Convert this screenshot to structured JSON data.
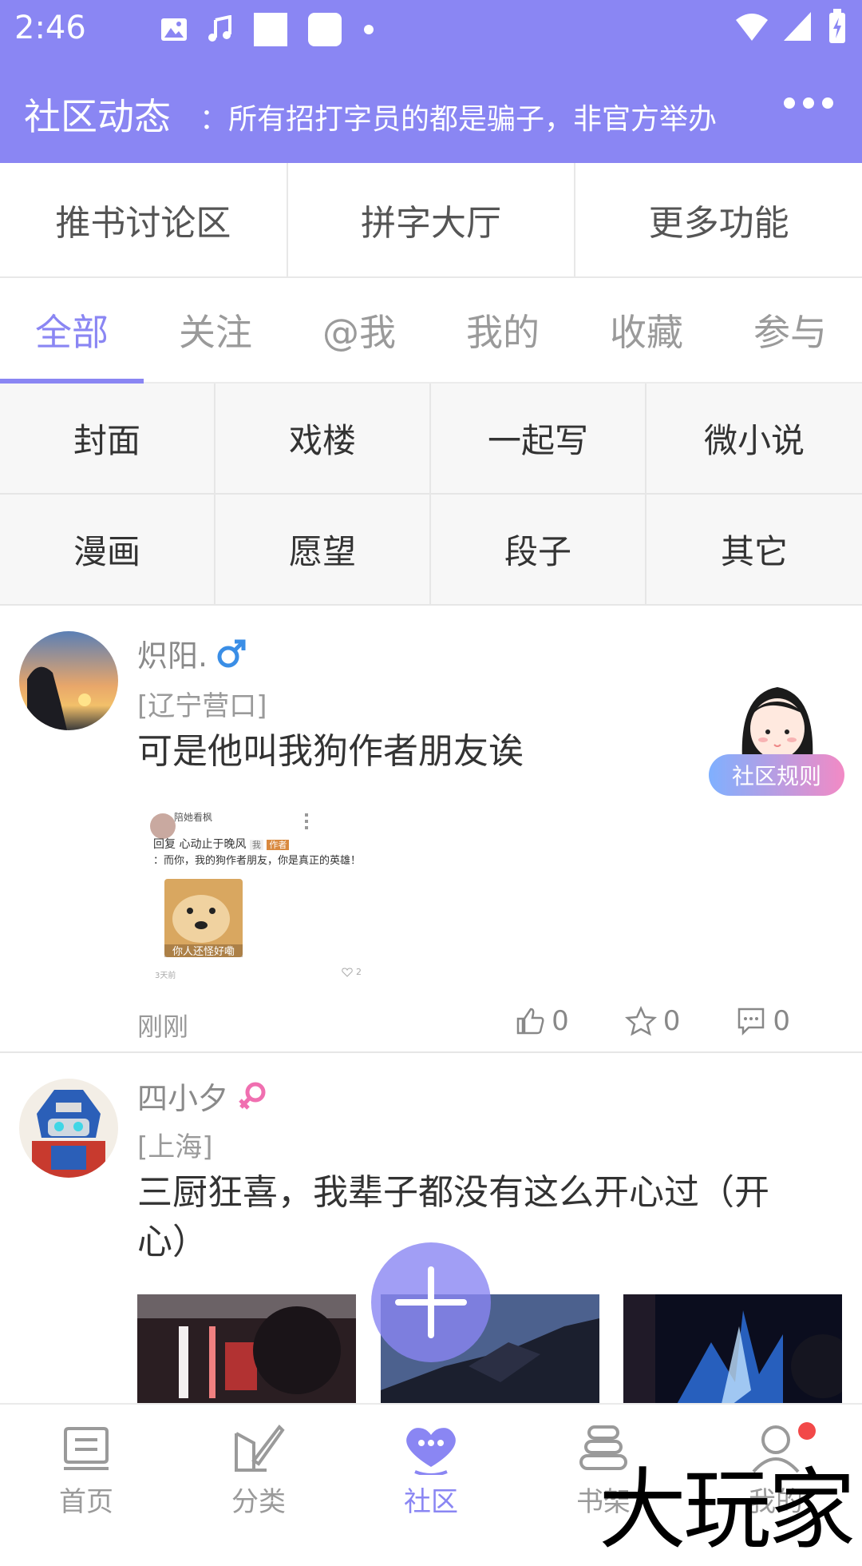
{
  "status_bar": {
    "time": "2:46"
  },
  "app_bar": {
    "title": "社区动态",
    "notice": "：所有招打字员的都是骗子，非官方举办"
  },
  "function_bar": [
    "推书讨论区",
    "拼字大厅",
    "更多功能"
  ],
  "tabs": [
    "全部",
    "关注",
    "@我",
    "我的",
    "收藏",
    "参与"
  ],
  "categories": [
    "封面",
    "戏楼",
    "一起写",
    "微小说",
    "漫画",
    "愿望",
    "段子",
    "其它"
  ],
  "rules_badge": "社区规则",
  "posts": [
    {
      "username": "炽阳.",
      "gender": "male",
      "location": "[辽宁营口]",
      "content": "可是他叫我狗作者朋友诶",
      "screenshot": {
        "user": "陪她看枫",
        "reply_text": "回复 心动止于晚风",
        "tag1": "我",
        "tag2": "作者",
        "message": "：而你，我的狗作者朋友，你是真正的英雄！",
        "sticker_caption": "你人还怪好嘞",
        "age": "3天前",
        "likes": "2"
      },
      "time": "刚刚",
      "likes": "0",
      "favorites": "0",
      "comments": "0"
    },
    {
      "username": "四小夕",
      "gender": "female",
      "location": "[上海]",
      "content": "三厨狂喜，我辈子都没有这么开心过（开心）"
    }
  ],
  "bottom_nav": [
    "首页",
    "分类",
    "社区",
    "书架",
    "我的"
  ],
  "watermark": "大玩家",
  "colors": {
    "accent": "#8a86f3",
    "male": "#3a8ee6",
    "female": "#f06fb0"
  }
}
